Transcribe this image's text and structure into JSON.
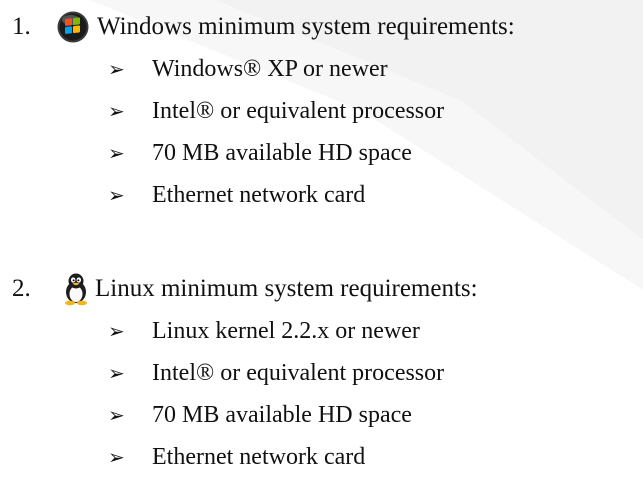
{
  "sections": [
    {
      "number": "1.",
      "icon": "windows-logo-icon",
      "title": "Windows minimum system requirements:",
      "items": [
        "Windows® XP or newer",
        "Intel® or equivalent processor",
        "70 MB available HD space",
        "Ethernet network card"
      ]
    },
    {
      "number": "2.",
      "icon": "tux-penguin-icon",
      "title": "Linux minimum system requirements:",
      "items": [
        "Linux kernel 2.2.x or newer",
        "Intel® or equivalent processor",
        "70 MB available HD space",
        "Ethernet network card"
      ]
    }
  ],
  "bullet_glyph": "➢",
  "colors": {
    "text": "#111111",
    "background_shape": "#f2f2f2"
  }
}
